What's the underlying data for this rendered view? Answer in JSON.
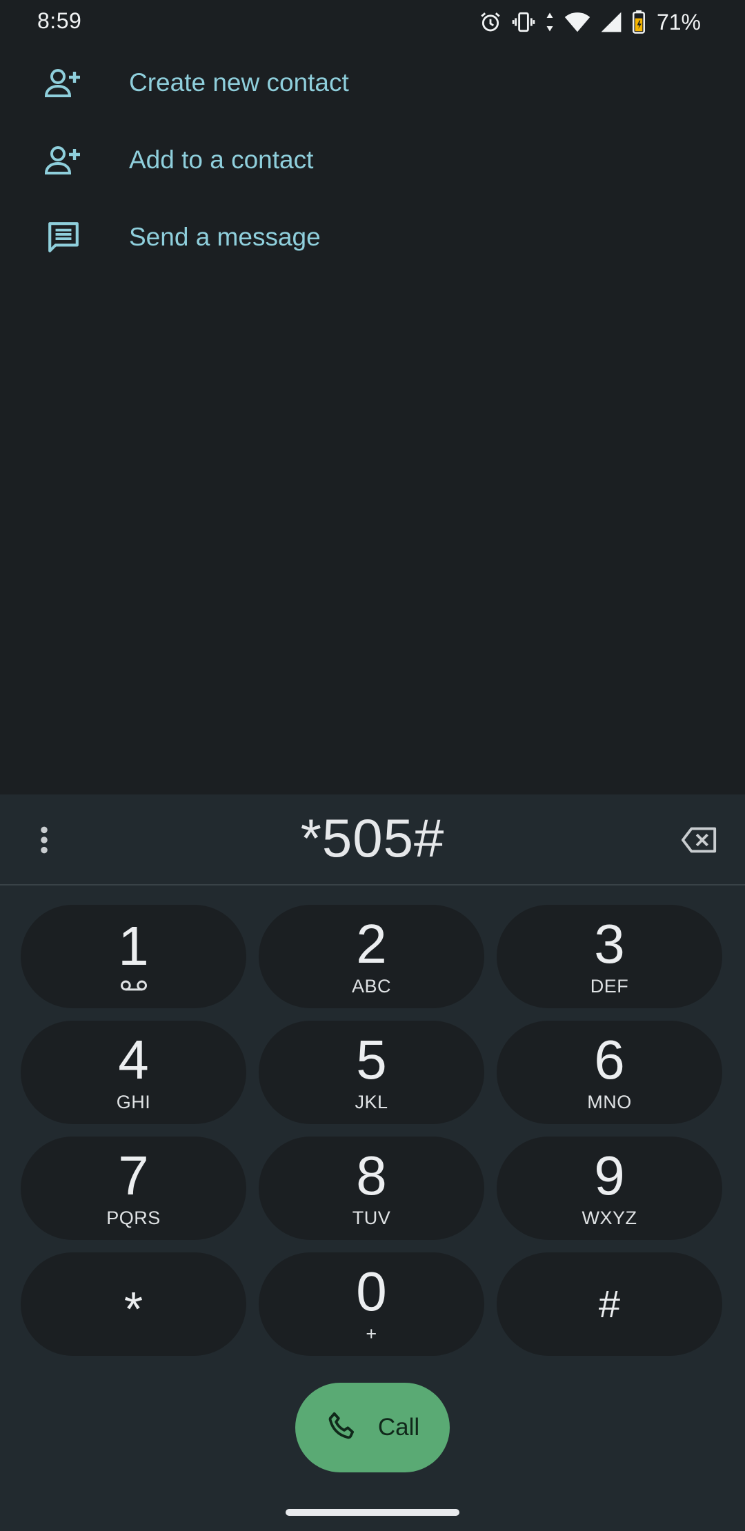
{
  "status_bar": {
    "time": "8:59",
    "battery": "71%",
    "icons": [
      "alarm-icon",
      "vibrate-icon",
      "data-arrows-icon",
      "wifi-icon",
      "signal-icon",
      "battery-icon"
    ]
  },
  "suggestions": [
    {
      "label": "Create new contact",
      "icon": "add-person-icon"
    },
    {
      "label": "Add to a contact",
      "icon": "add-person-icon"
    },
    {
      "label": "Send a message",
      "icon": "message-icon"
    }
  ],
  "dialpad": {
    "digits": "*505#",
    "keys": [
      {
        "num": "1",
        "sub": "",
        "icon": "voicemail-icon"
      },
      {
        "num": "2",
        "sub": "ABC"
      },
      {
        "num": "3",
        "sub": "DEF"
      },
      {
        "num": "4",
        "sub": "GHI"
      },
      {
        "num": "5",
        "sub": "JKL"
      },
      {
        "num": "6",
        "sub": "MNO"
      },
      {
        "num": "7",
        "sub": "PQRS"
      },
      {
        "num": "8",
        "sub": "TUV"
      },
      {
        "num": "9",
        "sub": "WXYZ"
      },
      {
        "num": "*",
        "sub": ""
      },
      {
        "num": "0",
        "sub": "+"
      },
      {
        "num": "#",
        "sub": ""
      }
    ],
    "call_label": "Call"
  },
  "colors": {
    "background": "#1b1f22",
    "panel": "#222a2f",
    "accent_text": "#8fcfdc",
    "call_button": "#5aaa74"
  }
}
